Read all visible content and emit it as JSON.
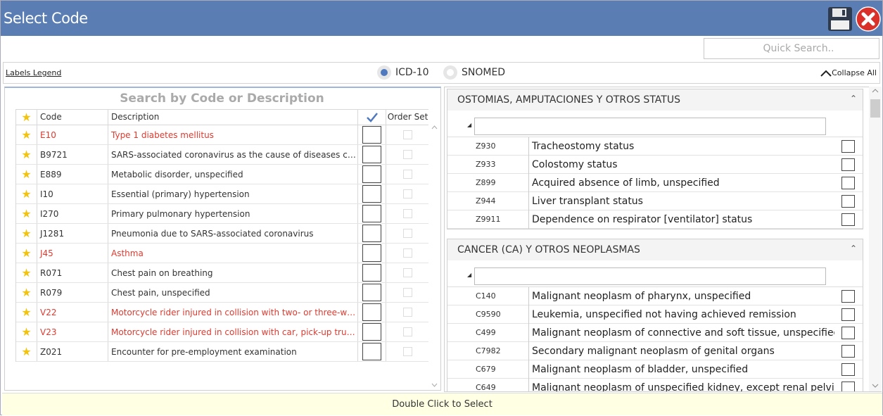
{
  "window": {
    "title": "Select Code"
  },
  "toolbar": {
    "quick_search_placeholder": "Quick Search.."
  },
  "legend_bar": {
    "labels_legend": "Labels Legend",
    "radio_options": [
      {
        "label": "ICD-10",
        "selected": true
      },
      {
        "label": "SNOMED",
        "selected": false
      }
    ],
    "collapse_all": "Collapse All"
  },
  "left_panel": {
    "search_placeholder": "Search by Code or Description",
    "columns": {
      "code": "Code",
      "description": "Description",
      "order_set": "Order Set"
    },
    "rows": [
      {
        "code": "E10",
        "description": "Type 1 diabetes mellitus",
        "highlight": true
      },
      {
        "code": "B9721",
        "description": "SARS-associated coronavirus as the cause of diseases classified...",
        "highlight": false
      },
      {
        "code": "E889",
        "description": "Metabolic disorder, unspecified",
        "highlight": false
      },
      {
        "code": "I10",
        "description": "Essential (primary) hypertension",
        "highlight": false
      },
      {
        "code": "I270",
        "description": "Primary pulmonary hypertension",
        "highlight": false
      },
      {
        "code": "J1281",
        "description": "Pneumonia due to SARS-associated coronavirus",
        "highlight": false
      },
      {
        "code": "J45",
        "description": "Asthma",
        "highlight": true
      },
      {
        "code": "R071",
        "description": "Chest pain on breathing",
        "highlight": false
      },
      {
        "code": "R079",
        "description": "Chest pain, unspecified",
        "highlight": false
      },
      {
        "code": "V22",
        "description": "Motorcycle rider injured in collision with two- or three-wheeled...",
        "highlight": true
      },
      {
        "code": "V23",
        "description": "Motorcycle rider injured in collision with car, pick-up truck or van",
        "highlight": true
      },
      {
        "code": "Z021",
        "description": "Encounter for pre-employment examination",
        "highlight": false
      }
    ]
  },
  "right_panel": {
    "groups": [
      {
        "title": "OSTOMIAS, AMPUTACIONES Y OTROS STATUS",
        "rows": [
          {
            "code": "Z930",
            "description": "Tracheostomy status"
          },
          {
            "code": "Z933",
            "description": "Colostomy status"
          },
          {
            "code": "Z899",
            "description": "Acquired absence of limb, unspecified"
          },
          {
            "code": "Z944",
            "description": "Liver transplant status"
          },
          {
            "code": "Z9911",
            "description": "Dependence on respirator [ventilator] status"
          }
        ]
      },
      {
        "title": "CANCER (CA) Y OTROS NEOPLASMAS",
        "rows": [
          {
            "code": "C140",
            "description": "Malignant neoplasm of pharynx, unspecified"
          },
          {
            "code": "C9590",
            "description": "Leukemia, unspecified not having achieved remission"
          },
          {
            "code": "C499",
            "description": "Malignant neoplasm of connective and soft tissue, unspecified"
          },
          {
            "code": "C7982",
            "description": "Secondary malignant neoplasm of genital organs"
          },
          {
            "code": "C679",
            "description": "Malignant neoplasm of bladder, unspecified"
          },
          {
            "code": "C649",
            "description": "Malignant neoplasm of unspecified kidney, except renal pelvis"
          }
        ]
      }
    ]
  },
  "footer": {
    "hint": "Double Click to Select"
  },
  "colors": {
    "titlebar": "#5a7db4",
    "highlight_text": "#e03a2f",
    "star": "#f2c40f",
    "footer_bg": "#ffffe3"
  }
}
